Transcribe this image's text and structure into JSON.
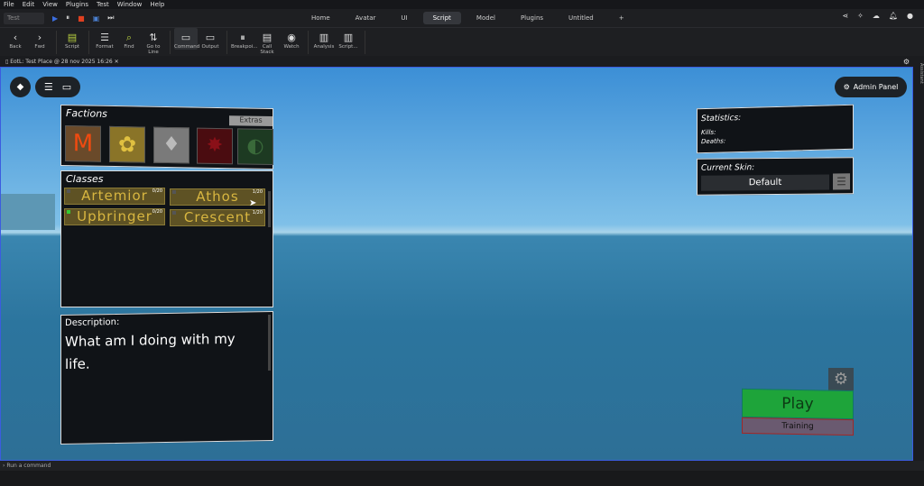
{
  "menu": [
    "File",
    "Edit",
    "View",
    "Plugins",
    "Test",
    "Window",
    "Help"
  ],
  "test_select": "Test",
  "tabs": [
    "Home",
    "Avatar",
    "UI",
    "Script",
    "Model",
    "Plugins",
    "Untitled",
    "+"
  ],
  "ribbon": [
    {
      "icon": "‹",
      "label": "Back"
    },
    {
      "icon": "›",
      "label": "Fwd"
    },
    {
      "icon": "▤",
      "label": "Script"
    },
    {
      "icon": "☰",
      "label": "Format"
    },
    {
      "icon": "⌕",
      "label": "Find"
    },
    {
      "icon": "⇅",
      "label": "Go to Line"
    },
    {
      "icon": "▭",
      "label": "Command"
    },
    {
      "icon": "▭",
      "label": "Output"
    },
    {
      "icon": "⏸",
      "label": "Breakpoi..."
    },
    {
      "icon": "▤",
      "label": "Call Stack"
    },
    {
      "icon": "◉",
      "label": "Watch"
    },
    {
      "icon": "▥",
      "label": "Analysis"
    },
    {
      "icon": "▥",
      "label": "Script..."
    }
  ],
  "doc_tab": "EotL: Test Place @ 28 nov 2025 16:26",
  "assistant": "Assistant",
  "command_placeholder": "Run a command",
  "game": {
    "admin_panel": "Admin Panel",
    "factions_title": "Factions",
    "extras": "Extras",
    "classes_title": "Classes",
    "classes": [
      {
        "name": "Artemior",
        "count": "0/20"
      },
      {
        "name": "Athos",
        "count": "1/20"
      },
      {
        "name": "Upbringer",
        "count": "0/20"
      },
      {
        "name": "Crescent",
        "count": "1/20"
      }
    ],
    "description_label": "Description:",
    "description": "What am I doing with my life.",
    "statistics": "Statistics:",
    "kills": "Kills:",
    "deaths": "Deaths:",
    "current_skin": "Current Skin:",
    "skin_value": "Default",
    "play": "Play",
    "training": "Training"
  }
}
